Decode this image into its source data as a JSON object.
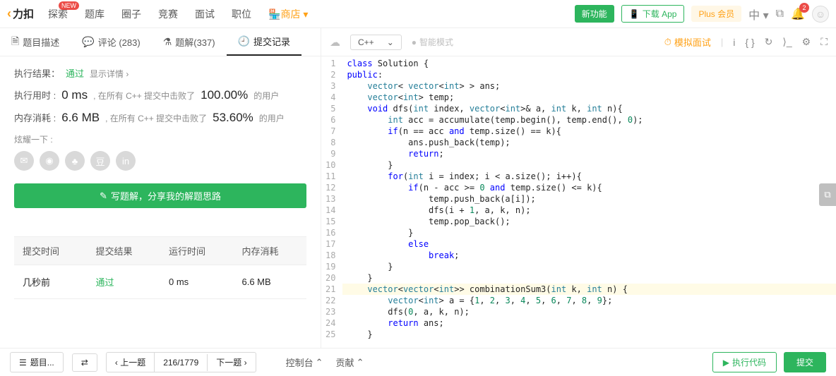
{
  "nav": {
    "logo": "力扣",
    "items": [
      "探索",
      "题库",
      "圈子",
      "竞赛",
      "面试",
      "职位",
      "商店"
    ],
    "new_badge": "NEW",
    "new_feature": "新功能",
    "download": "下载 App",
    "plus": "Plus 会员",
    "lang": "中",
    "bell_count": "2",
    "store_icon_text": "🏪"
  },
  "tabs": {
    "desc": "题目描述",
    "comments": "评论 (283)",
    "solutions": "题解(337)",
    "submissions": "提交记录"
  },
  "result": {
    "label": "执行结果：",
    "status": "通过",
    "detail": "显示详情 ›",
    "time_label": "执行用时 :",
    "time_val": "0 ms",
    "time_desc1": ", 在所有 C++ 提交中击败了",
    "time_pct": "100.00%",
    "time_desc2": "的用户",
    "mem_label": "内存消耗 :",
    "mem_val": "6.6 MB",
    "mem_desc1": ", 在所有 C++ 提交中击败了",
    "mem_pct": "53.60%",
    "mem_desc2": "的用户",
    "share_label": "炫耀一下 :",
    "write_solution": "写题解，分享我的解题思路"
  },
  "table": {
    "h1": "提交时间",
    "h2": "提交结果",
    "h3": "运行时间",
    "h4": "内存消耗",
    "r1c1": "几秒前",
    "r1c2": "通过",
    "r1c3": "0 ms",
    "r1c4": "6.6 MB"
  },
  "editor_bar": {
    "lang": "C++",
    "smart": "智能模式",
    "mock": "模拟面试"
  },
  "code": {
    "lines": [
      "class Solution {",
      "public:",
      "    vector< vector<int> > ans;",
      "    vector<int> temp;",
      "    void dfs(int index, vector<int>& a, int k, int n){",
      "        int acc = accumulate(temp.begin(), temp.end(), 0);",
      "        if(n == acc and temp.size() == k){",
      "            ans.push_back(temp);",
      "            return;",
      "        }",
      "        for(int i = index; i < a.size(); i++){",
      "            if(n - acc >= 0 and temp.size() <= k){",
      "                temp.push_back(a[i]);",
      "                dfs(i + 1, a, k, n);",
      "                temp.pop_back();",
      "            }",
      "            else",
      "                break;",
      "        }",
      "    }",
      "    vector<vector<int>> combinationSum3(int k, int n) {",
      "        vector<int> a = {1, 2, 3, 4, 5, 6, 7, 8, 9};",
      "        dfs(0, a, k, n);",
      "        return ans;",
      "    }"
    ],
    "highlight_line": 21
  },
  "bottom": {
    "problems": "题目...",
    "prev": "上一题",
    "counter": "216/1779",
    "next": "下一题",
    "console": "控制台",
    "contribute": "贡献",
    "run": "执行代码",
    "submit": "提交"
  }
}
